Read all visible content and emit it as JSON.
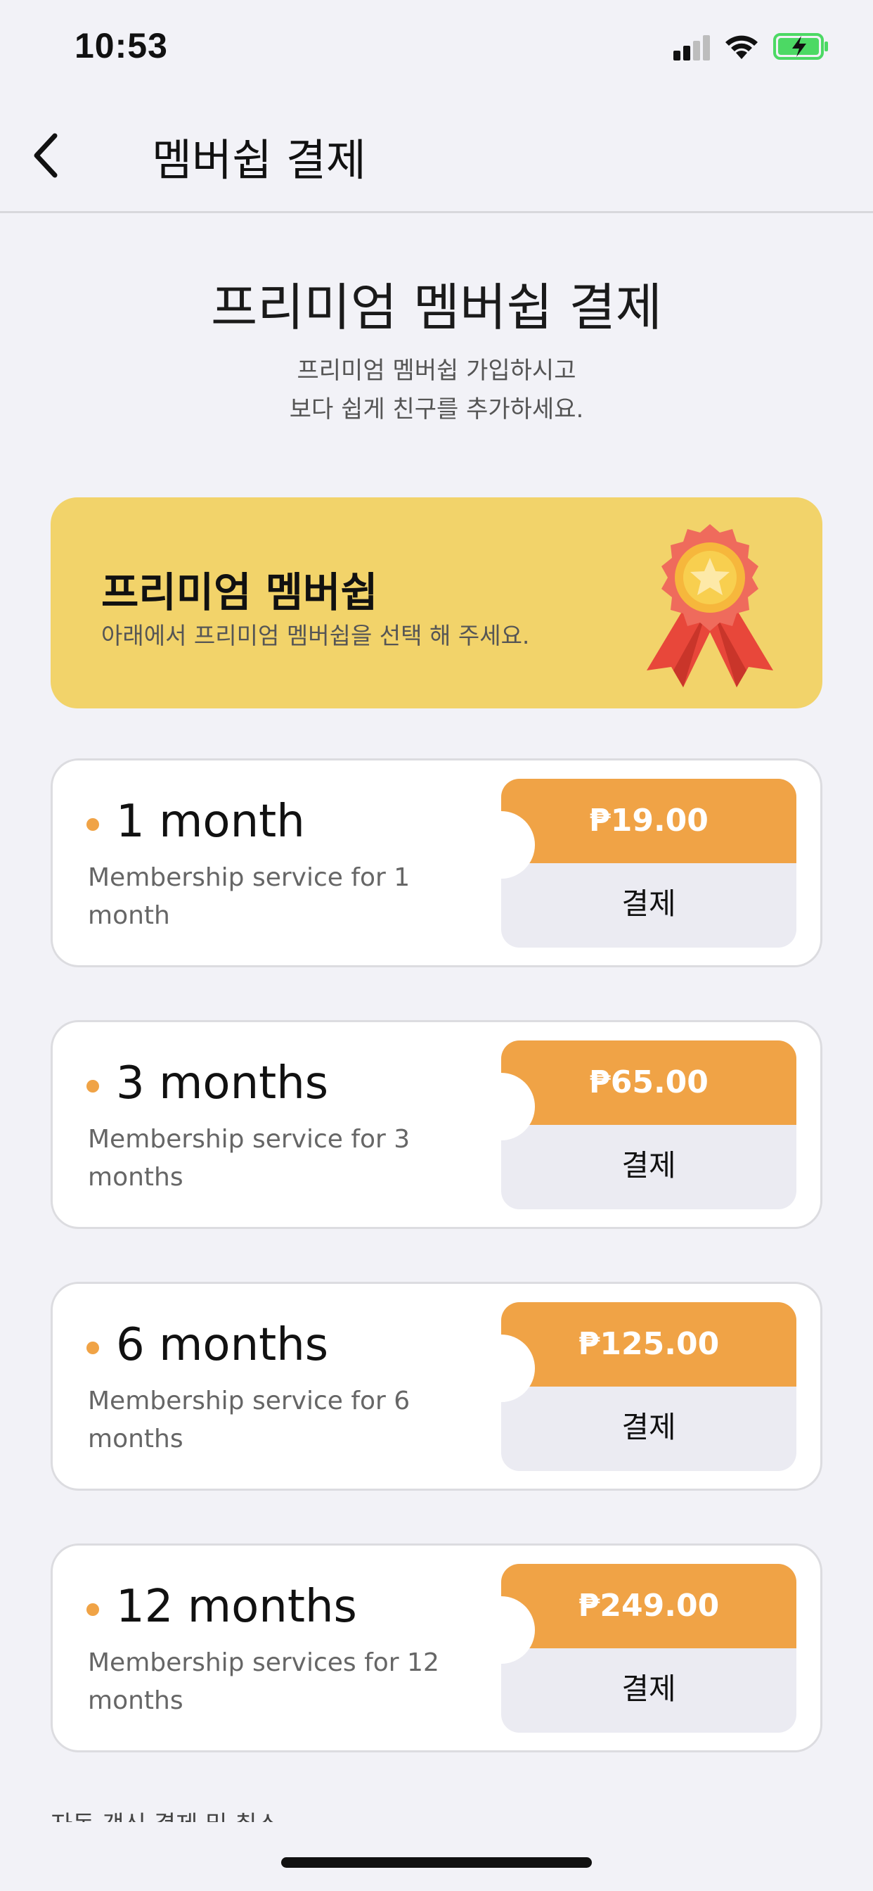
{
  "status_bar": {
    "time": "10:53"
  },
  "nav": {
    "title": "멤버쉽 결제"
  },
  "header": {
    "title": "프리미엄 멤버쉽 결제",
    "subtitle_line1": "프리미엄 멤버쉽 가입하시고",
    "subtitle_line2": "보다 쉽게 친구를 추가하세요."
  },
  "banner": {
    "title": "프리미엄 멤버쉽",
    "subtitle": "아래에서 프리미엄 멤버쉽을 선택 해 주세요.",
    "icon": "award-ribbon-icon"
  },
  "plans": [
    {
      "title": "1 month",
      "desc": "Membership service for 1 month",
      "price": "₱19.00",
      "pay_label": "결제"
    },
    {
      "title": "3 months",
      "desc": "Membership service for 3 months",
      "price": "₱65.00",
      "pay_label": "결제"
    },
    {
      "title": "6 months",
      "desc": "Membership service for 6 months",
      "price": "₱125.00",
      "pay_label": "결제"
    },
    {
      "title": "12 months",
      "desc": "Membership services for 12 months",
      "price": "₱249.00",
      "pay_label": "결제"
    }
  ],
  "footnote": "자동 갱신 결제 및 취소",
  "colors": {
    "accent": "#f0a346",
    "banner": "#f2d36a",
    "background": "#f2f2f7",
    "battery": "#4cd964"
  }
}
